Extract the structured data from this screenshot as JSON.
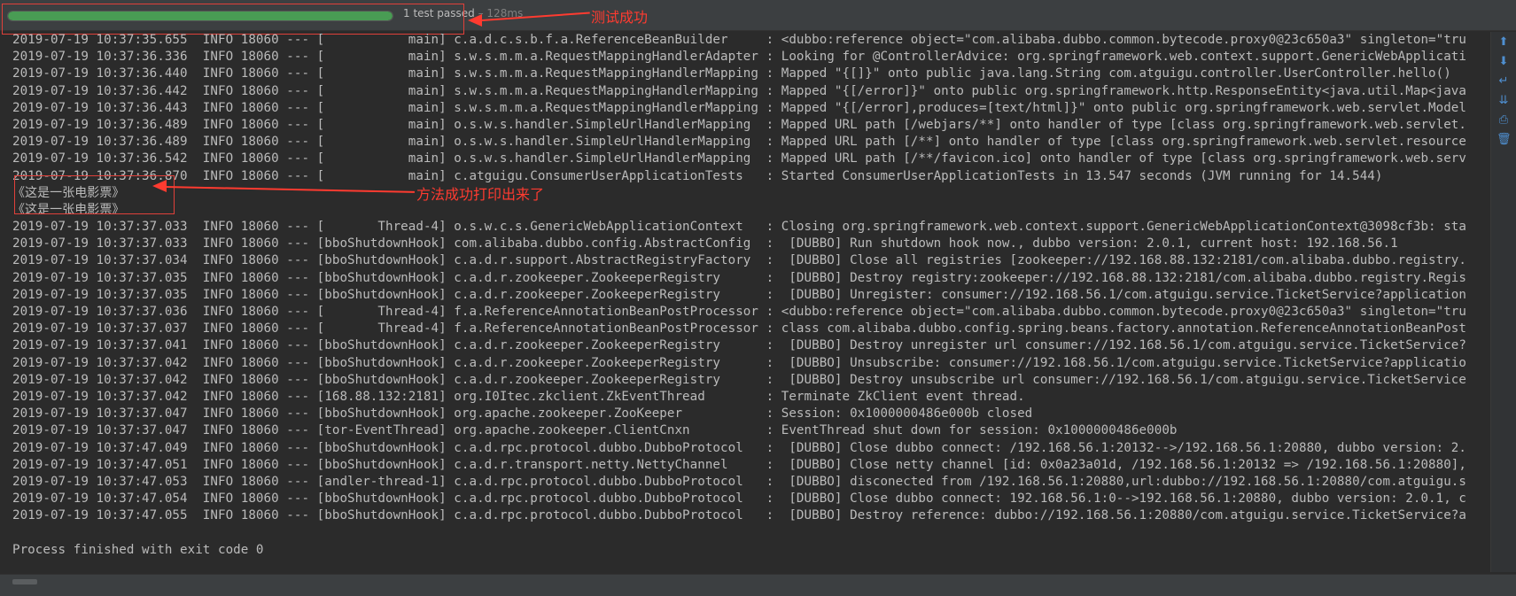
{
  "test_bar": {
    "progress_percent": 100,
    "status_text": "1 test passed",
    "duration_text": " – 128ms"
  },
  "annotations": {
    "success_label": "测试成功",
    "printed_label": "方法成功打印出来了"
  },
  "colors": {
    "progress": "#499c54",
    "annotation": "#ff3b30",
    "console_text": "#bbbbbb"
  },
  "console": {
    "lines": [
      "2019-07-19 10:37:35.655  INFO 18060 --- [           main] c.a.d.c.s.b.f.a.ReferenceBeanBuilder     : <dubbo:reference object=\"com.alibaba.dubbo.common.bytecode.proxy0@23c650a3\" singleton=\"tru",
      "2019-07-19 10:37:36.336  INFO 18060 --- [           main] s.w.s.m.m.a.RequestMappingHandlerAdapter : Looking for @ControllerAdvice: org.springframework.web.context.support.GenericWebApplicati",
      "2019-07-19 10:37:36.440  INFO 18060 --- [           main] s.w.s.m.m.a.RequestMappingHandlerMapping : Mapped \"{[]}\" onto public java.lang.String com.atguigu.controller.UserController.hello()",
      "2019-07-19 10:37:36.442  INFO 18060 --- [           main] s.w.s.m.m.a.RequestMappingHandlerMapping : Mapped \"{[/error]}\" onto public org.springframework.http.ResponseEntity<java.util.Map<java",
      "2019-07-19 10:37:36.443  INFO 18060 --- [           main] s.w.s.m.m.a.RequestMappingHandlerMapping : Mapped \"{[/error],produces=[text/html]}\" onto public org.springframework.web.servlet.Model",
      "2019-07-19 10:37:36.489  INFO 18060 --- [           main] o.s.w.s.handler.SimpleUrlHandlerMapping  : Mapped URL path [/webjars/**] onto handler of type [class org.springframework.web.servlet.",
      "2019-07-19 10:37:36.489  INFO 18060 --- [           main] o.s.w.s.handler.SimpleUrlHandlerMapping  : Mapped URL path [/**] onto handler of type [class org.springframework.web.servlet.resource",
      "2019-07-19 10:37:36.542  INFO 18060 --- [           main] o.s.w.s.handler.SimpleUrlHandlerMapping  : Mapped URL path [/**/favicon.ico] onto handler of type [class org.springframework.web.serv",
      "2019-07-19 10:37:36.870  INFO 18060 --- [           main] c.atguigu.ConsumerUserApplicationTests   : Started ConsumerUserApplicationTests in 13.547 seconds (JVM running for 14.544)",
      "《这是一张电影票》",
      "《这是一张电影票》",
      "2019-07-19 10:37:37.033  INFO 18060 --- [       Thread-4] o.s.w.c.s.GenericWebApplicationContext   : Closing org.springframework.web.context.support.GenericWebApplicationContext@3098cf3b: sta",
      "2019-07-19 10:37:37.033  INFO 18060 --- [bboShutdownHook] com.alibaba.dubbo.config.AbstractConfig  :  [DUBBO] Run shutdown hook now., dubbo version: 2.0.1, current host: 192.168.56.1",
      "2019-07-19 10:37:37.034  INFO 18060 --- [bboShutdownHook] c.a.d.r.support.AbstractRegistryFactory  :  [DUBBO] Close all registries [zookeeper://192.168.88.132:2181/com.alibaba.dubbo.registry.",
      "2019-07-19 10:37:37.035  INFO 18060 --- [bboShutdownHook] c.a.d.r.zookeeper.ZookeeperRegistry      :  [DUBBO] Destroy registry:zookeeper://192.168.88.132:2181/com.alibaba.dubbo.registry.Regis",
      "2019-07-19 10:37:37.035  INFO 18060 --- [bboShutdownHook] c.a.d.r.zookeeper.ZookeeperRegistry      :  [DUBBO] Unregister: consumer://192.168.56.1/com.atguigu.service.TicketService?application",
      "2019-07-19 10:37:37.036  INFO 18060 --- [       Thread-4] f.a.ReferenceAnnotationBeanPostProcessor : <dubbo:reference object=\"com.alibaba.dubbo.common.bytecode.proxy0@23c650a3\" singleton=\"tru",
      "2019-07-19 10:37:37.037  INFO 18060 --- [       Thread-4] f.a.ReferenceAnnotationBeanPostProcessor : class com.alibaba.dubbo.config.spring.beans.factory.annotation.ReferenceAnnotationBeanPost",
      "2019-07-19 10:37:37.041  INFO 18060 --- [bboShutdownHook] c.a.d.r.zookeeper.ZookeeperRegistry      :  [DUBBO] Destroy unregister url consumer://192.168.56.1/com.atguigu.service.TicketService?",
      "2019-07-19 10:37:37.042  INFO 18060 --- [bboShutdownHook] c.a.d.r.zookeeper.ZookeeperRegistry      :  [DUBBO] Unsubscribe: consumer://192.168.56.1/com.atguigu.service.TicketService?applicatio",
      "2019-07-19 10:37:37.042  INFO 18060 --- [bboShutdownHook] c.a.d.r.zookeeper.ZookeeperRegistry      :  [DUBBO] Destroy unsubscribe url consumer://192.168.56.1/com.atguigu.service.TicketService",
      "2019-07-19 10:37:37.042  INFO 18060 --- [168.88.132:2181] org.I0Itec.zkclient.ZkEventThread        : Terminate ZkClient event thread.",
      "2019-07-19 10:37:37.047  INFO 18060 --- [bboShutdownHook] org.apache.zookeeper.ZooKeeper           : Session: 0x1000000486e000b closed",
      "2019-07-19 10:37:37.047  INFO 18060 --- [tor-EventThread] org.apache.zookeeper.ClientCnxn          : EventThread shut down for session: 0x1000000486e000b",
      "2019-07-19 10:37:47.049  INFO 18060 --- [bboShutdownHook] c.a.d.rpc.protocol.dubbo.DubboProtocol   :  [DUBBO] Close dubbo connect: /192.168.56.1:20132-->/192.168.56.1:20880, dubbo version: 2.",
      "2019-07-19 10:37:47.051  INFO 18060 --- [bboShutdownHook] c.a.d.r.transport.netty.NettyChannel     :  [DUBBO] Close netty channel [id: 0x0a23a01d, /192.168.56.1:20132 => /192.168.56.1:20880],",
      "2019-07-19 10:37:47.053  INFO 18060 --- [andler-thread-1] c.a.d.rpc.protocol.dubbo.DubboProtocol   :  [DUBBO] disconected from /192.168.56.1:20880,url:dubbo://192.168.56.1:20880/com.atguigu.s",
      "2019-07-19 10:37:47.054  INFO 18060 --- [bboShutdownHook] c.a.d.rpc.protocol.dubbo.DubboProtocol   :  [DUBBO] Close dubbo connect: 192.168.56.1:0-->192.168.56.1:20880, dubbo version: 2.0.1, c",
      "2019-07-19 10:37:47.055  INFO 18060 --- [bboShutdownHook] c.a.d.rpc.protocol.dubbo.DubboProtocol   :  [DUBBO] Destroy reference: dubbo://192.168.56.1:20880/com.atguigu.service.TicketService?a",
      "",
      "Process finished with exit code 0"
    ]
  }
}
